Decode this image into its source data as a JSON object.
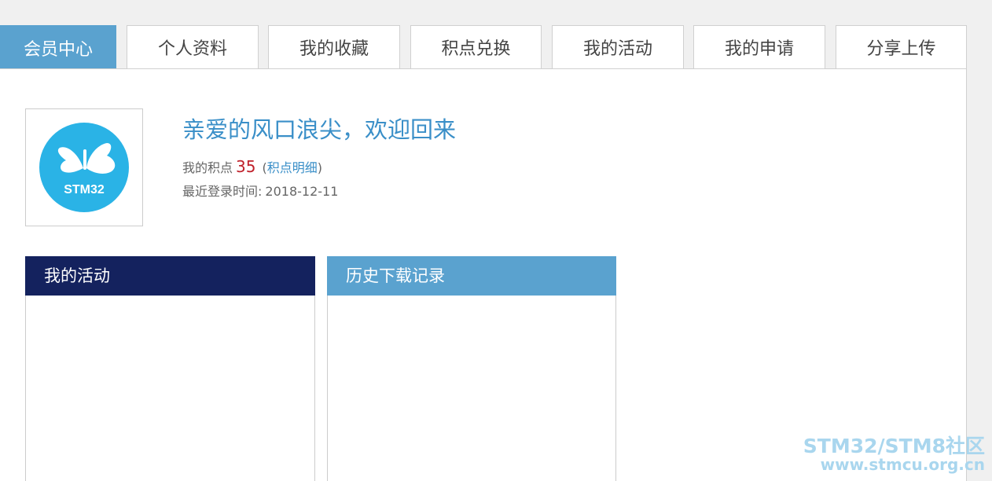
{
  "tabs": [
    {
      "label": "会员中心",
      "active": true
    },
    {
      "label": "个人资料",
      "active": false
    },
    {
      "label": "我的收藏",
      "active": false
    },
    {
      "label": "积点兑换",
      "active": false
    },
    {
      "label": "我的活动",
      "active": false
    },
    {
      "label": "我的申请",
      "active": false
    },
    {
      "label": "分享上传",
      "active": false
    }
  ],
  "profile": {
    "avatar_logo_text": "STM32",
    "welcome": "亲爱的风口浪尖，欢迎回来",
    "points_label": "我的积点",
    "points_value": "35",
    "points_paren_open": "(",
    "points_link": "积点明细",
    "points_paren_close": ")",
    "last_login_label": "最近登录时间:",
    "last_login_value": "2018-12-11"
  },
  "panels": {
    "activity_title": "我的活动",
    "history_title": "历史下载记录"
  },
  "watermark": {
    "line1": "STM32/STM8社区",
    "line2": "www.stmcu.org.cn"
  },
  "colors": {
    "accent": "#5aa2cf",
    "navy": "#14225e",
    "points": "#c0212b",
    "link": "#3a8fc8"
  }
}
